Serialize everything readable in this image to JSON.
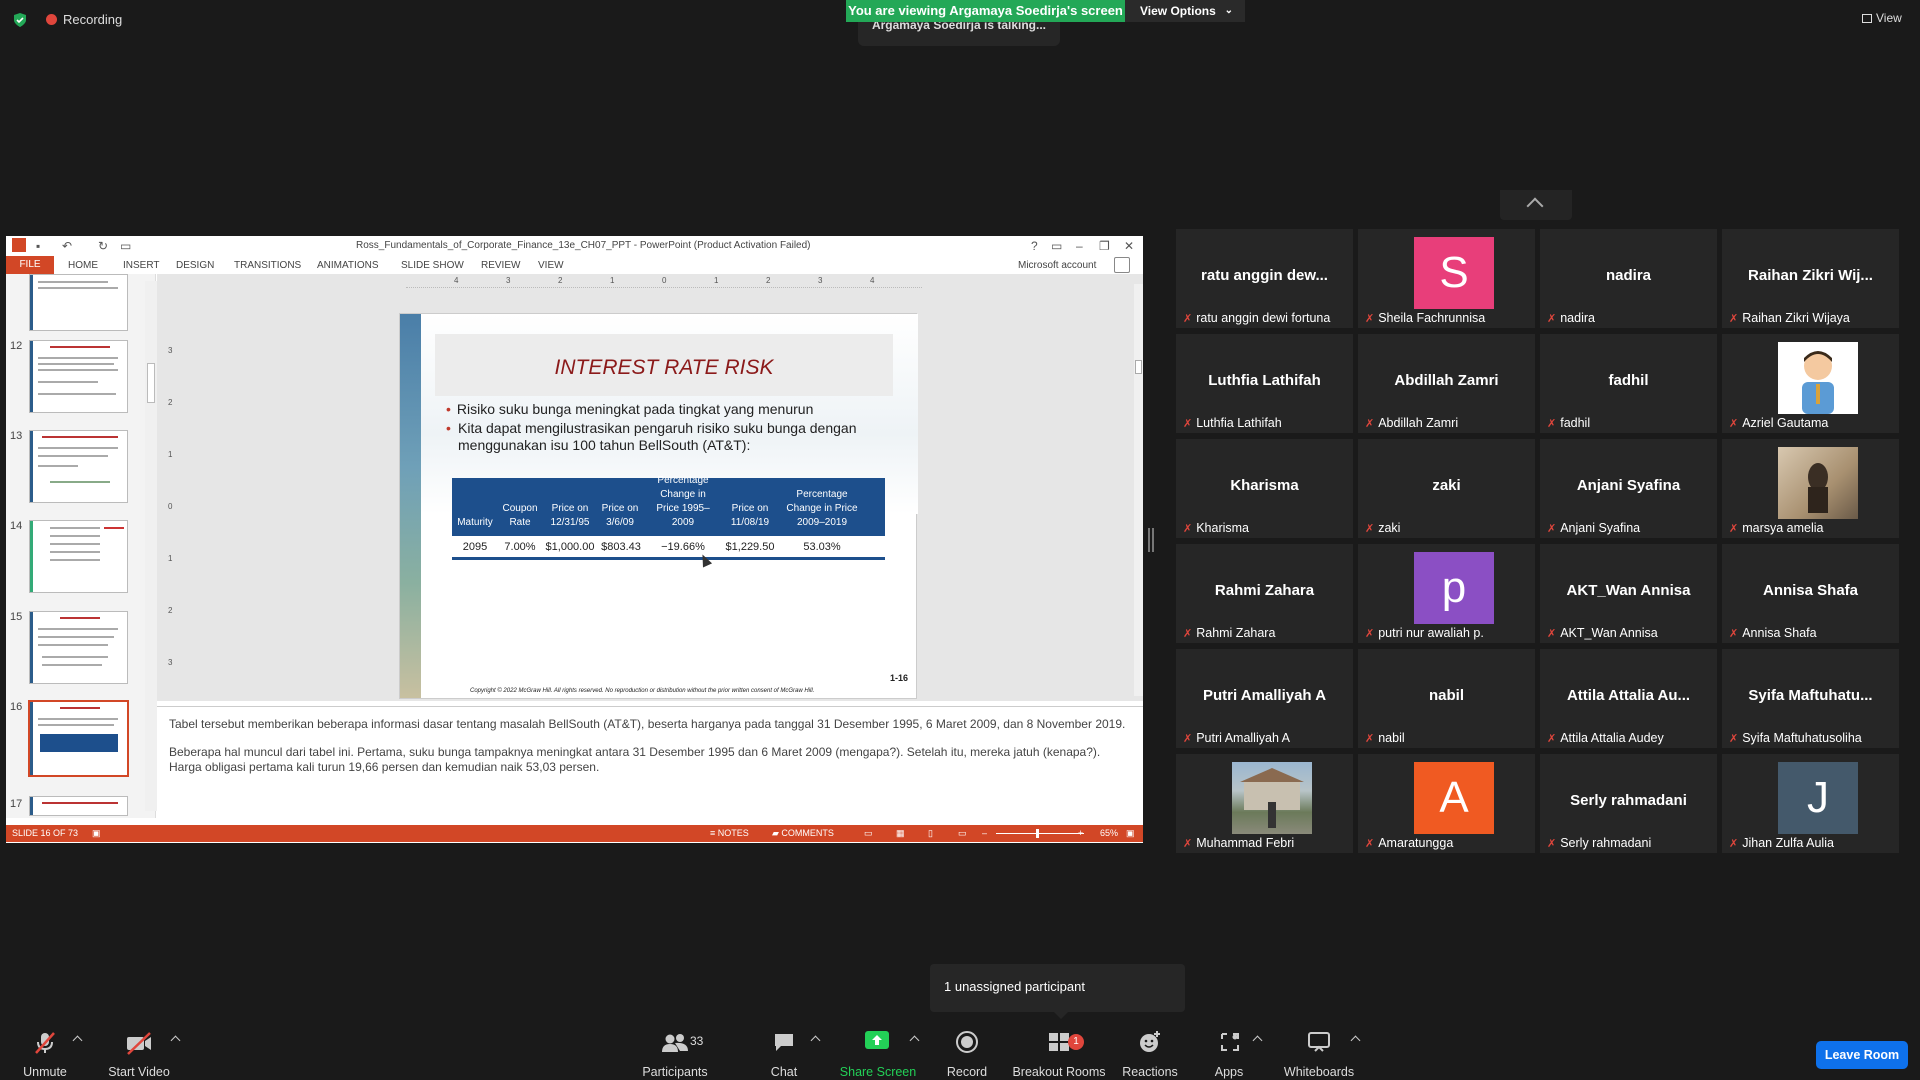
{
  "topbar": {
    "recording": "Recording",
    "viewing_banner": "You are viewing Argamaya Soedirja's screen",
    "view_options": "View Options",
    "talking": "Argamaya Soedirja is talking...",
    "view": "View"
  },
  "ppt": {
    "title": "Ross_Fundamentals_of_Corporate_Finance_13e_CH07_PPT - PowerPoint (Product Activation Failed)",
    "tabs": [
      "FILE",
      "HOME",
      "INSERT",
      "DESIGN",
      "TRANSITIONS",
      "ANIMATIONS",
      "SLIDE SHOW",
      "REVIEW",
      "VIEW"
    ],
    "account": "Microsoft account",
    "thumb_numbers": [
      "12",
      "13",
      "14",
      "15",
      "16",
      "17"
    ],
    "ruler_h": [
      "4",
      "3",
      "2",
      "1",
      "0",
      "1",
      "2",
      "3",
      "4"
    ],
    "ruler_v": [
      "3",
      "2",
      "1",
      "0",
      "1",
      "2",
      "3"
    ],
    "slide": {
      "title": "INTEREST RATE RISK",
      "bullets": [
        "Risiko suku bunga meningkat pada tingkat yang menurun",
        "Kita dapat mengilustrasikan pengaruh risiko suku bunga dengan menggunakan isu 100 tahun BellSouth (AT&T):"
      ],
      "table_headers": [
        "Maturity",
        "Coupon Rate",
        "Price on 12/31/95",
        "Price on 3/6/09",
        "Percentage Change in Price 1995–2009",
        "Price on 11/08/19",
        "Percentage Change in Price 2009–2019"
      ],
      "table_row": [
        "2095",
        "7.00%",
        "$1,000.00",
        "$803.43",
        "−19.66%",
        "$1,229.50",
        "53.03%"
      ],
      "slide_number": "1-16",
      "copyright": "Copyright © 2022 McGraw Hill. All rights reserved. No reproduction or distribution without the prior written consent of McGraw Hill."
    },
    "notes": [
      "Tabel tersebut memberikan beberapa informasi dasar tentang masalah BellSouth (AT&T), beserta harganya pada tanggal 31 Desember 1995, 6 Maret 2009, dan 8 November 2019.",
      "Beberapa hal muncul dari tabel ini. Pertama, suku bunga tampaknya meningkat antara 31 Desember 1995 dan 6 Maret 2009 (mengapa?). Setelah itu, mereka jatuh (kenapa?). Harga obligasi pertama kali turun 19,66 persen dan kemudian naik 53,03 persen."
    ],
    "status": {
      "slide": "SLIDE 16 OF 73",
      "notes": "NOTES",
      "comments": "COMMENTS",
      "zoom": "65%"
    }
  },
  "participants": [
    {
      "name": "ratu anggin dew...",
      "label": "ratu anggin dewi fortuna"
    },
    {
      "name": "",
      "label": "Sheila Fachrunnisa",
      "avatar": "S",
      "color": "#e83e7a"
    },
    {
      "name": "nadira",
      "label": "nadira"
    },
    {
      "name": "Raihan Zikri Wij...",
      "label": "Raihan Zikri Wijaya"
    },
    {
      "name": "Luthfia Lathifah",
      "label": "Luthfia Lathifah"
    },
    {
      "name": "Abdillah Zamri",
      "label": "Abdillah Zamri"
    },
    {
      "name": "fadhil",
      "label": "fadhil"
    },
    {
      "name": "",
      "label": "Azriel Gautama",
      "photo": "cartoon"
    },
    {
      "name": "Kharisma",
      "label": "Kharisma"
    },
    {
      "name": "zaki",
      "label": "zaki"
    },
    {
      "name": "Anjani Syafina",
      "label": "Anjani Syafina"
    },
    {
      "name": "",
      "label": "marsya amelia",
      "photo": "beige"
    },
    {
      "name": "Rahmi Zahara",
      "label": "Rahmi Zahara"
    },
    {
      "name": "",
      "label": "putri nur awaliah p.",
      "avatar": "p",
      "color": "#8b4fc4"
    },
    {
      "name": "AKT_Wan Annisa",
      "label": "AKT_Wan Annisa"
    },
    {
      "name": "Annisa Shafa",
      "label": "Annisa Shafa"
    },
    {
      "name": "Putri Amalliyah A",
      "label": "Putri Amalliyah A"
    },
    {
      "name": "nabil",
      "label": "nabil"
    },
    {
      "name": "Attila Attalia Au...",
      "label": "Attila Attalia Audey"
    },
    {
      "name": "Syifa Maftuhatu...",
      "label": "Syifa Maftuhatusoliha"
    },
    {
      "name": "",
      "label": "Muhammad Febri",
      "photo": "building"
    },
    {
      "name": "",
      "label": "Amaratungga",
      "avatar": "A",
      "color": "#f05a22"
    },
    {
      "name": "Serly rahmadani",
      "label": "Serly rahmadani"
    },
    {
      "name": "",
      "label": "Jihan Zulfa Aulia",
      "avatar": "J",
      "color": "#44596b"
    }
  ],
  "unassigned": "1 unassigned participant",
  "toolbar": {
    "unmute": "Unmute",
    "start_video": "Start Video",
    "participants": "Participants",
    "participants_count": "33",
    "chat": "Chat",
    "share_screen": "Share Screen",
    "record": "Record",
    "breakout_rooms": "Breakout Rooms",
    "breakout_badge": "1",
    "reactions": "Reactions",
    "apps": "Apps",
    "whiteboards": "Whiteboards",
    "leave": "Leave Room"
  }
}
